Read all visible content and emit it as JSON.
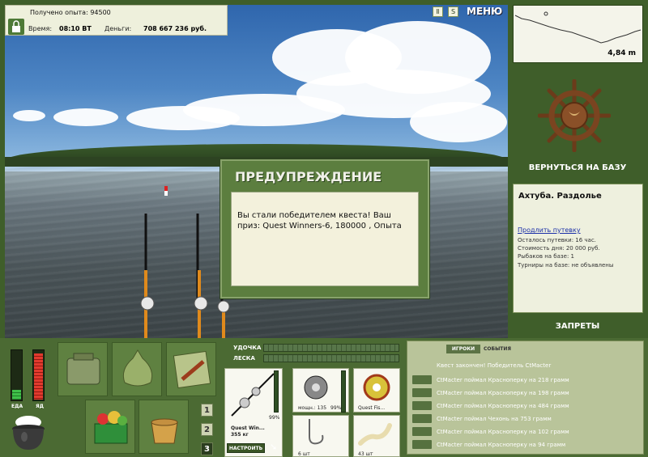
{
  "hud": {
    "exp_label": "Получено опыта: 94500",
    "time_label": "Время:",
    "time_value": "08:10 ВТ",
    "money_label": "Деньги:",
    "money_value": "708 667 236 руб."
  },
  "top": {
    "pause_icon": "pause-icon",
    "sound_icon": "sound-icon",
    "menu_label": "МЕНЮ"
  },
  "dialog": {
    "title": "ПРЕДУПРЕЖДЕНИЕ",
    "message": "Вы стали победителем квеста! Ваш приз: Quest Winners-6, 180000 , Опыта"
  },
  "map": {
    "depth": "4,84 m"
  },
  "sidebar": {
    "return_label": "ВЕРНУТЬСЯ НА БАЗУ",
    "location": "Ахтуба. Раздолье",
    "extend_link": "Продлить путевку",
    "lines": [
      "Осталось путевки: 16 час.",
      "Стоимость дня: 20 000 руб.",
      "Рыбаков на базе: 1",
      "Турниры на базе: не объявлены"
    ],
    "bans_label": "ЗАПРЕТЫ"
  },
  "status": {
    "food_label": "ЕДА",
    "poison_label": "ЯД",
    "food_level": 0.2,
    "poison_level": 0.92
  },
  "slots": {
    "pages": [
      "1",
      "2",
      "3"
    ]
  },
  "tackle": {
    "rod_label": "УДОЧКА",
    "line_label": "ЛЕСКА",
    "rod_name": "Quest Win...",
    "rod_weight": "355 кг",
    "rod_percent": "99%",
    "reel_caption": "мощн.: 135",
    "reel_percent": "99%",
    "line_caption": "Quest Fis...",
    "hook_caption": "6 шт",
    "bait_caption": "43 шт",
    "setup_label": "НАСТРОИТЬ"
  },
  "events": {
    "tab_players": "ИГРОКИ",
    "tab_events": "СОБЫТИЯ",
    "headline": "Квест закончен! Победитель CtMacter",
    "rows": [
      "CtMacter поймал Красноперку на 218 грамм",
      "CtMacter поймал Красноперку на 198 грамм",
      "CtMacter поймал Красноперку на 484 грамм",
      "CtMacter поймал Чехонь на 753 грамм",
      "CtMacter поймал Красноперку на 102 грамм",
      "CtMacter поймал Красноперку на 94 грамм"
    ]
  }
}
